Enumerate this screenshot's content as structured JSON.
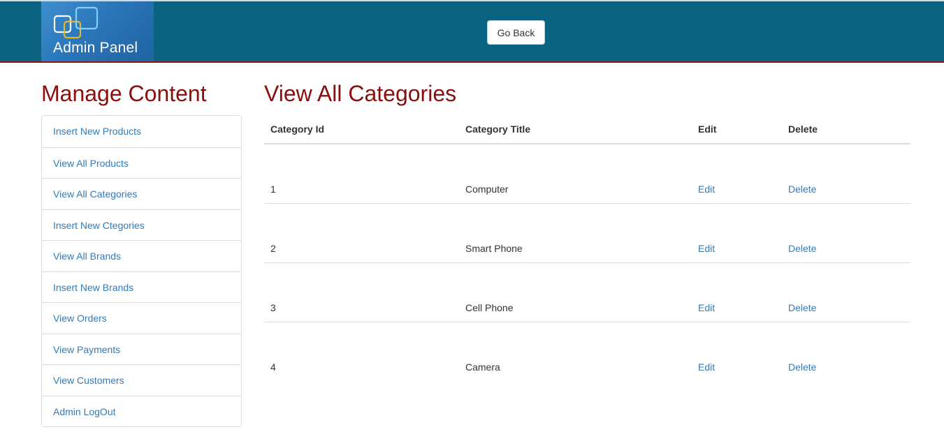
{
  "header": {
    "logo_text": "Admin Panel",
    "go_back_label": "Go Back",
    "background_color": "#0b6281",
    "underline_color": "#8c1a1a"
  },
  "sidebar": {
    "title": "Manage Content",
    "items": [
      {
        "label": "Insert New Products"
      },
      {
        "label": "View All Products"
      },
      {
        "label": "View All Categories"
      },
      {
        "label": "Insert New Ctegories"
      },
      {
        "label": "View All Brands"
      },
      {
        "label": "Insert New Brands"
      },
      {
        "label": "View Orders"
      },
      {
        "label": "View Payments"
      },
      {
        "label": "View Customers"
      },
      {
        "label": "Admin LogOut"
      }
    ]
  },
  "main": {
    "title": "View All Categories",
    "columns": [
      "Category Id",
      "Category Title",
      "Edit",
      "Delete"
    ],
    "rows": [
      {
        "id": "1",
        "title": "Computer",
        "edit": "Edit",
        "delete": "Delete"
      },
      {
        "id": "2",
        "title": "Smart Phone",
        "edit": "Edit",
        "delete": "Delete"
      },
      {
        "id": "3",
        "title": "Cell Phone",
        "edit": "Edit",
        "delete": "Delete"
      },
      {
        "id": "4",
        "title": "Camera",
        "edit": "Edit",
        "delete": "Delete"
      }
    ]
  },
  "colors": {
    "heading": "#8b0e0e",
    "link": "#337ab7"
  }
}
